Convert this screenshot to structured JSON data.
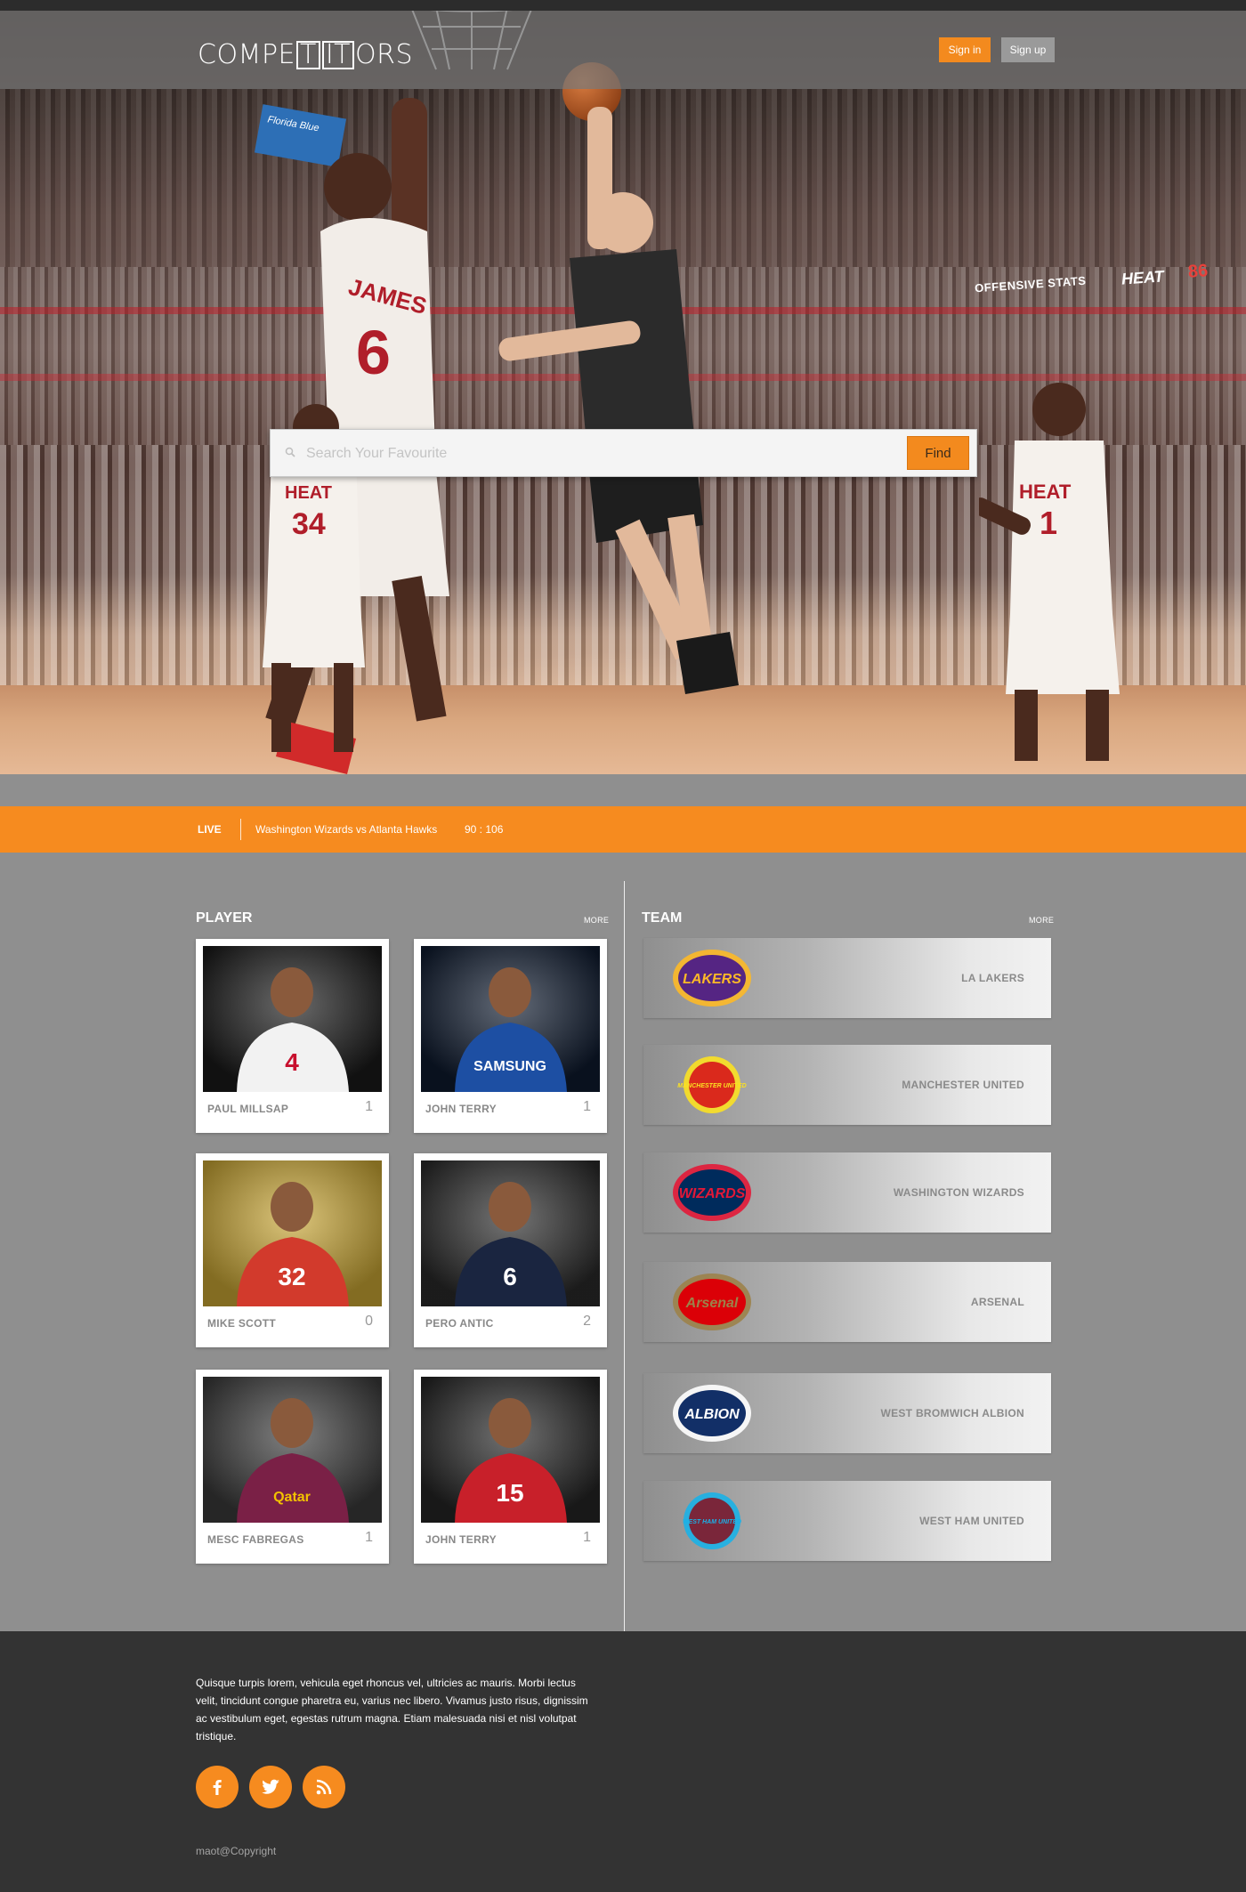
{
  "header": {
    "logo": {
      "pre": "COMPE",
      "boxed1": "T",
      "boxed2": "IT",
      "post": "ORS"
    },
    "sign_in": "Sign in",
    "sign_up": "Sign up"
  },
  "hero": {
    "scoreboard_label": "OFFENSIVE STATS",
    "scoreboard_team": "HEAT",
    "scoreboard_score": "86",
    "sponsor": "Florida Blue",
    "jerseys": [
      {
        "name": "JAMES",
        "number": "6"
      },
      {
        "name": "HEAT",
        "number": "34"
      },
      {
        "name": "HEAT",
        "number": "1"
      }
    ]
  },
  "search": {
    "placeholder": "Search Your Favourite",
    "button": "Find"
  },
  "live": {
    "label": "LIVE",
    "match": "Washington Wizards  vs  Atlanta Hawks",
    "score": "90 : 106"
  },
  "players": {
    "title": "PLAYER",
    "more": "MORE",
    "items": [
      {
        "name": "PAUL MILLSAP",
        "count": "1",
        "jersey": "#f2f2f2",
        "number": "4",
        "bg": "#1a1a1a",
        "text": "#c8102e"
      },
      {
        "name": "JOHN TERRY",
        "count": "1",
        "jersey": "#1d4fa3",
        "number": "SAMSUNG",
        "bg": "#0e1a2e",
        "text": "#ffffff"
      },
      {
        "name": "MIKE SCOTT",
        "count": "0",
        "jersey": "#d23a2c",
        "number": "32",
        "bg": "#c9a634",
        "text": "#ffffff"
      },
      {
        "name": "PERO ANTIC",
        "count": "2",
        "jersey": "#1a2540",
        "number": "6",
        "bg": "#2a2a2a",
        "text": "#ffffff"
      },
      {
        "name": "MESC FABREGAS",
        "count": "1",
        "jersey": "#7a2046",
        "number": "Qatar",
        "bg": "#3b3b3b",
        "text": "#f2c200"
      },
      {
        "name": "JOHN TERRY",
        "count": "1",
        "jersey": "#c8202a",
        "number": "15",
        "bg": "#252525",
        "text": "#ffffff"
      }
    ]
  },
  "teams": {
    "title": "TEAM",
    "more": "MORE",
    "items": [
      {
        "name": "LA LAKERS",
        "logo_text": "LAKERS",
        "logo_color": "#552583",
        "logo_accent": "#fdb927"
      },
      {
        "name": "MANCHESTER UNITED",
        "logo_text": "MANCHESTER UNITED",
        "logo_color": "#da291c",
        "logo_accent": "#fbe122"
      },
      {
        "name": "WASHINGTON WIZARDS",
        "logo_text": "WIZARDS",
        "logo_color": "#002b5c",
        "logo_accent": "#e31837"
      },
      {
        "name": "ARSENAL",
        "logo_text": "Arsenal",
        "logo_color": "#db0007",
        "logo_accent": "#9c824a"
      },
      {
        "name": "WEST BROMWICH ALBION",
        "logo_text": "ALBION",
        "logo_color": "#122f67",
        "logo_accent": "#ffffff"
      },
      {
        "name": "WEST HAM UNITED",
        "logo_text": "WEST HAM UNITED",
        "logo_color": "#7a263a",
        "logo_accent": "#1bb1e7"
      }
    ]
  },
  "footer": {
    "text": "Quisque turpis lorem, vehicula eget rhoncus vel, ultricies ac mauris. Morbi lectus velit, tincidunt congue pharetra eu, varius nec libero. Vivamus justo risus, dignissim ac vestibulum eget, egestas rutrum magna. Etiam malesuada nisi et nisl volutpat tristique.",
    "social": [
      "facebook-icon",
      "twitter-icon",
      "rss-icon"
    ],
    "copyright": "maot@Copyright"
  },
  "colors": {
    "accent": "#f68b1f",
    "content_bg": "#8f8f8f",
    "footer_bg": "#333333"
  }
}
